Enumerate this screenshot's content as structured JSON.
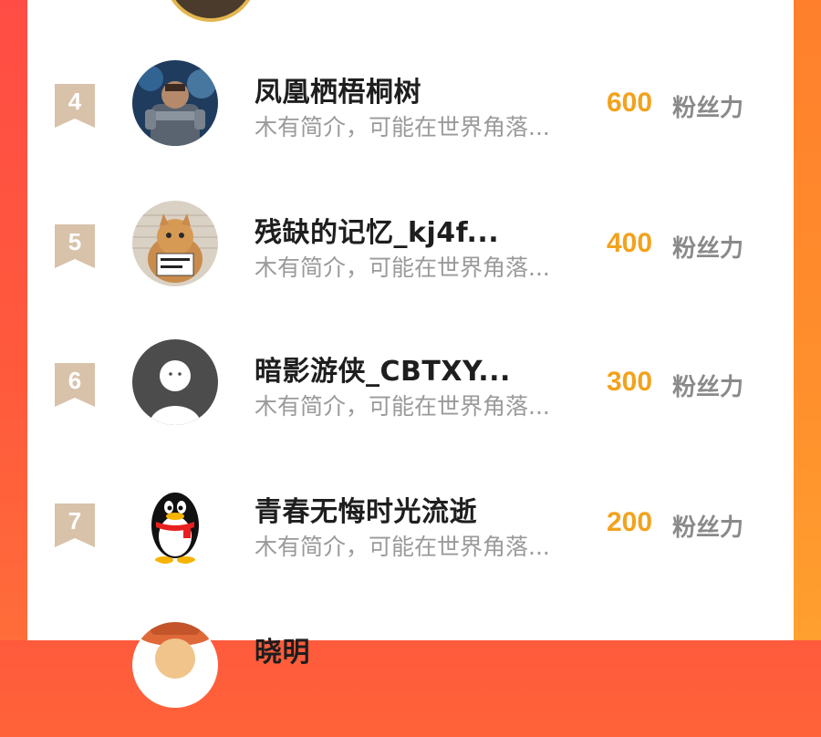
{
  "colors": {
    "background_gradient_start": "#ff5a3c",
    "background_gradient_end": "#ff9a30",
    "score": "#f2a21c",
    "name": "#1e1e1e",
    "bio": "#9a9a9a",
    "badge": "#d8c2aa"
  },
  "leaderboard": {
    "unit_label": "粉丝力",
    "rows": [
      {
        "rank": "4",
        "name": "凤凰栖梧桐树",
        "bio": "木有简介，可能在世界角落...",
        "score": "600",
        "avatar_icon": "armored-warrior-avatar"
      },
      {
        "rank": "5",
        "name": "残缺的记忆_kj4f...",
        "bio": "木有简介，可能在世界角落...",
        "score": "400",
        "avatar_icon": "cat-mugshot-avatar"
      },
      {
        "rank": "6",
        "name": "暗影游侠_CBTXY...",
        "bio": "木有简介，可能在世界角落...",
        "score": "300",
        "avatar_icon": "default-user-avatar"
      },
      {
        "rank": "7",
        "name": "青春无悔时光流逝",
        "bio": "木有简介，可能在世界角落...",
        "score": "200",
        "avatar_icon": "qq-penguin-avatar"
      },
      {
        "rank": "",
        "name": "晓明",
        "bio": "",
        "score": "",
        "avatar_icon": "cartoon-hat-avatar"
      }
    ]
  }
}
